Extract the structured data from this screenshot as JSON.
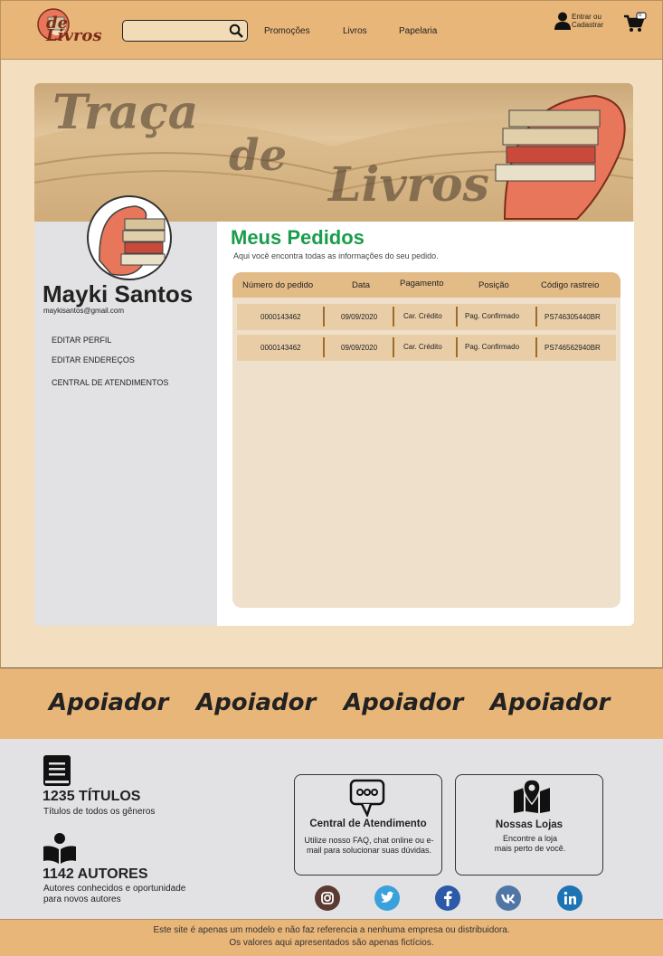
{
  "header": {
    "logo_text": "de Livros",
    "search_placeholder": "",
    "nav": [
      "Promoções",
      "Livros",
      "Papelaria"
    ],
    "account_line1": "Entrar ou",
    "account_line2": "Cadastrar",
    "cart_count": "0"
  },
  "banner": {
    "line1": "Traça",
    "line2": "de",
    "line3": "Livros"
  },
  "profile": {
    "name": "Mayki Santos",
    "email": "maykisantos@gmail.com",
    "links": [
      "EDITAR PERFIL",
      "EDITAR ENDEREÇOS",
      "CENTRAL DE ATENDIMENTOS"
    ]
  },
  "orders": {
    "title": "Meus Pedidos",
    "subtitle": "Aqui você encontra todas as informações do seu pedido.",
    "columns": [
      "Número do pedido",
      "Data",
      "Pagamento",
      "Posição",
      "Código rastreio"
    ],
    "rows": [
      [
        "0000143462",
        "09/09/2020",
        "Car. Crédito",
        "Pag. Confirmado",
        "PS746305440BR"
      ],
      [
        "0000143462",
        "09/09/2020",
        "Car. Crédito",
        "Pag. Confirmado",
        "PS746562940BR"
      ]
    ]
  },
  "sponsors": [
    "Apoiador",
    "Apoiador",
    "Apoiador",
    "Apoiador"
  ],
  "stats": {
    "titles_num": "1235 TÍTULOS",
    "titles_desc": "Títulos de todos os gêneros",
    "authors_num": "1142 AUTORES",
    "authors_desc1": "Autores conhecidos e oportunidade",
    "authors_desc2": "para novos autores"
  },
  "cards": {
    "support_title": "Central de Atendimento",
    "support_desc": "Utilize nosso FAQ, chat online ou e-mail para solucionar suas dúvidas.",
    "stores_title": "Nossas Lojas",
    "stores_desc1": "Encontre a loja",
    "stores_desc2": "mais perto de você."
  },
  "social_icons": [
    "instagram-icon",
    "twitter-icon",
    "facebook-icon",
    "vk-icon",
    "linkedin-icon"
  ],
  "footer": {
    "line1": "Este site é apenas um modelo e não faz referencia a nenhuma empresa ou distribuidora.",
    "line2": "Os valores aqui apresentados são apenas fictícios."
  },
  "colors": {
    "header_bg": "#e9b679",
    "title_green": "#1a9d4a",
    "panel_bg": "#efe0cc"
  }
}
